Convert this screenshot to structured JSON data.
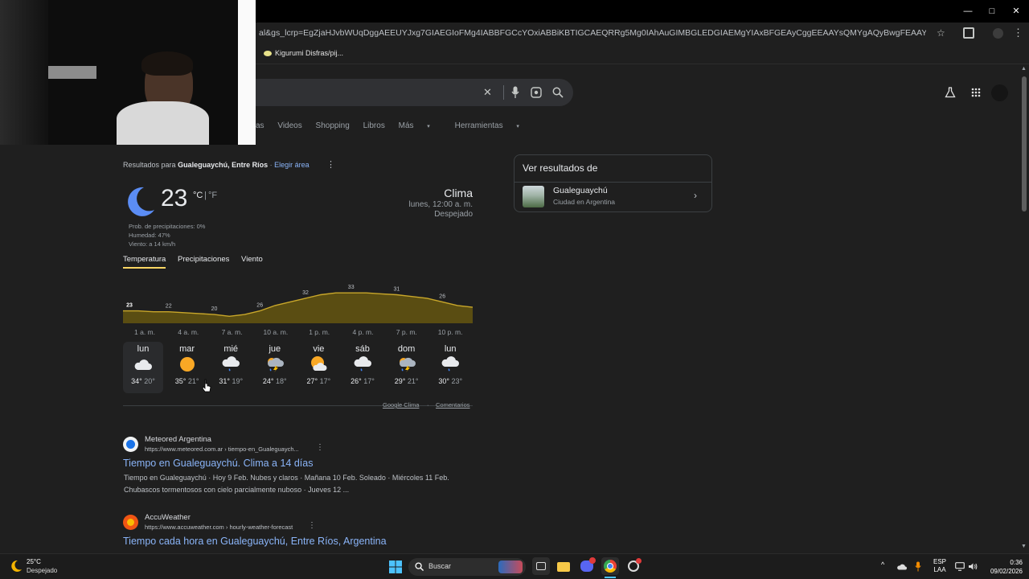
{
  "browser": {
    "url": "al&gs_lcrp=EgZjaHJvbWUqDggAEEUYJxg7GIAEGIoFMg4IABBFGCcYOxiABBiKBTIGCAEQRRg5Mg0IAhAuGIMBGLEDGIAEMgYIAxBFGEAyCggEEAAYsQMYgAQyBwgFEAAYgAQyDQgGEC4YgwEYsQMYgAQy8...",
    "bookmark_label": "Kigurumi Disfras/pij...",
    "window_controls": {
      "minimize": "—",
      "maximize": "□",
      "close": "✕"
    }
  },
  "search": {
    "tabs": [
      "as",
      "Videos",
      "Shopping",
      "Libros",
      "Más",
      "Herramientas"
    ]
  },
  "weather": {
    "results_for_prefix": "Resultados para",
    "results_for_location": "Gualeguaychú, Entre Ríos",
    "choose_area": "Elegir área",
    "temperature": "23",
    "unit_c": "°C",
    "unit_sep": " | ",
    "unit_f": "°F",
    "precip": "Prob. de precipitaciones: 0%",
    "humidity": "Humedad: 47%",
    "wind": "Viento: a 14 km/h",
    "heading": "Clima",
    "datetime": "lunes, 12:00 a. m.",
    "condition": "Despejado",
    "tabs": [
      "Temperatura",
      "Precipitaciones",
      "Viento"
    ],
    "hour_labels": [
      "1 a. m.",
      "4 a. m.",
      "7 a. m.",
      "10 a. m.",
      "1 p. m.",
      "4 p. m.",
      "7 p. m.",
      "10 p. m."
    ],
    "days": [
      {
        "name": "lun",
        "icon": "cloud",
        "hi": "34°",
        "lo": "20°"
      },
      {
        "name": "mar",
        "icon": "sun",
        "hi": "35°",
        "lo": "21°"
      },
      {
        "name": "mié",
        "icon": "rain-cloud",
        "hi": "31°",
        "lo": "19°"
      },
      {
        "name": "jue",
        "icon": "storm",
        "hi": "24°",
        "lo": "18°"
      },
      {
        "name": "vie",
        "icon": "sun-cloud",
        "hi": "27°",
        "lo": "17°"
      },
      {
        "name": "sáb",
        "icon": "rain-cloud",
        "hi": "26°",
        "lo": "17°"
      },
      {
        "name": "dom",
        "icon": "storm",
        "hi": "29°",
        "lo": "21°"
      },
      {
        "name": "lun",
        "icon": "rain-cloud",
        "hi": "30°",
        "lo": "23°"
      }
    ],
    "footer_source": "Google Clima",
    "footer_sep": "·",
    "footer_feedback": "Comentarios"
  },
  "chart_data": {
    "type": "area",
    "x": [
      "12 a. m.",
      "1 a. m.",
      "2 a. m.",
      "3 a. m.",
      "4 a. m.",
      "5 a. m.",
      "6 a. m.",
      "7 a. m.",
      "8 a. m.",
      "9 a. m.",
      "10 a. m.",
      "11 a. m.",
      "12 p. m.",
      "1 p. m.",
      "2 p. m.",
      "3 p. m.",
      "4 p. m.",
      "5 p. m.",
      "6 p. m.",
      "7 p. m.",
      "8 p. m.",
      "9 p. m.",
      "10 p. m.",
      "11 p. m."
    ],
    "values": [
      23,
      23,
      22.5,
      22.5,
      22,
      21.5,
      21,
      20,
      21,
      23,
      26,
      28,
      30,
      32,
      33,
      33,
      33,
      32.5,
      32,
      31,
      30,
      28,
      26,
      25
    ],
    "labels": [
      {
        "index": 0,
        "text": "23"
      },
      {
        "index": 3,
        "text": "22"
      },
      {
        "index": 6,
        "text": "20"
      },
      {
        "index": 9,
        "text": "26"
      },
      {
        "index": 12,
        "text": "32"
      },
      {
        "index": 15,
        "text": "33"
      },
      {
        "index": 18,
        "text": "31"
      },
      {
        "index": 21,
        "text": "26"
      }
    ],
    "fill_color": "#5a4d12",
    "line_color": "#c9a72a"
  },
  "side_panel": {
    "heading": "Ver resultados de",
    "item_title": "Gualeguaychú",
    "item_subtitle": "Ciudad en Argentina"
  },
  "results": [
    {
      "site": "Meteored Argentina",
      "url": "https://www.meteored.com.ar › tiempo-en_Gualeguaych...",
      "title": "Tiempo en Gualeguaychú. Clima a 14 días",
      "snippet_1": "Tiempo en Gualeguaychú · Hoy 9 Feb. Nubes y claros · Mañana 10 Feb. Soleado · Miércoles 11 Feb.",
      "snippet_2": "Chubascos tormentosos con cielo parcialmente nuboso · Jueves 12 ...",
      "color": "#1a73e8"
    },
    {
      "site": "AccuWeather",
      "url": "https://www.accuweather.com › hourly-weather-forecast",
      "title": "Tiempo cada hora en Gualeguaychú, Entre Ríos, Argentina",
      "color": "#f05514"
    }
  ],
  "taskbar": {
    "weather_temp": "25°C",
    "weather_cond": "Despejado",
    "search_placeholder": "Buscar",
    "lang_1": "ESP",
    "lang_2": "LAA",
    "time": "0:36",
    "date": "09/02/2026"
  }
}
